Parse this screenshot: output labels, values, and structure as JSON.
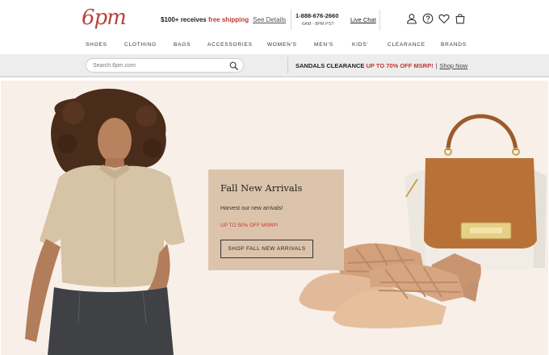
{
  "header": {
    "logo": "6pm",
    "promo": {
      "threshold": "$100+ receives ",
      "free": "free shipping",
      "details": "See Details"
    },
    "contact": {
      "phone": "1-888-676-2660",
      "hours": "6AM - 8PM PST"
    },
    "live_chat": "Live Chat",
    "icons": [
      "user-icon",
      "help-icon",
      "heart-icon",
      "shopping-bag-icon"
    ]
  },
  "nav": {
    "categories": [
      "SHOES",
      "CLOTHING",
      "BAGS",
      "ACCESSORIES",
      "WOMEN'S",
      "MEN'S",
      "KIDS'",
      "CLEARANCE",
      "BRANDS"
    ]
  },
  "search": {
    "placeholder": "Search 6pm.com"
  },
  "clearance": {
    "lead": "SANDALS CLEARANCE ",
    "highlight": "UP TO 70% OFF MSRP!",
    "separator": "|",
    "link": "Shop Now"
  },
  "hero": {
    "title": "Fall New Arrivals",
    "subtitle": "Harvest our new arrivals!",
    "offer": "UP TO 50% OFF MSRP!",
    "button": "SHOP FALL NEW ARRIVALS"
  },
  "colors": {
    "brand": "#b8433c",
    "sale_red": "#c4362c",
    "hero_bg": "#f8efe9",
    "card_bg": "#dcc4ac"
  }
}
